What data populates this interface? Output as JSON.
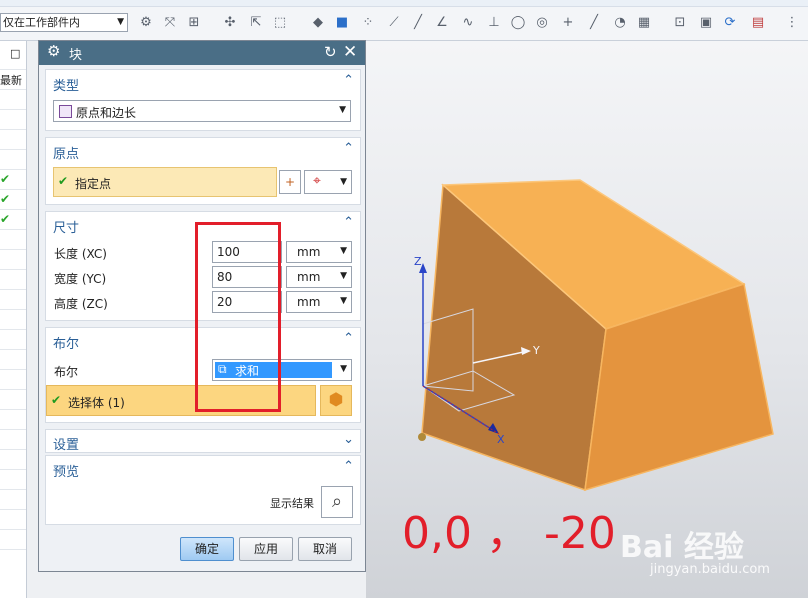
{
  "toolbar": {
    "scope_select": "仅在工作部件内",
    "icons": [
      "snap-icon",
      "filter-icon",
      "point-icon",
      "move-icon",
      "select-icon",
      "box-select-icon",
      "shade-icon",
      "cube-icon",
      "node-icon",
      "line-icon",
      "slash-icon",
      "angle-icon",
      "spline-icon",
      "tangent-icon",
      "circle-icon",
      "target-icon",
      "cross-icon",
      "slash2-icon",
      "sphere-icon",
      "grid-icon",
      "fit-icon",
      "view-icon",
      "refresh-icon",
      "layout-icon",
      "more-icon"
    ]
  },
  "navigator": {
    "header_label": "最新",
    "check_rows": [
      3,
      4,
      5
    ]
  },
  "dialog": {
    "title": "块",
    "type_section": {
      "title": "类型",
      "selected": "原点和边长"
    },
    "origin_section": {
      "title": "原点",
      "specify_point": "指定点"
    },
    "dimensions_section": {
      "title": "尺寸",
      "rows": [
        {
          "label": "长度 (XC)",
          "value": "100",
          "unit": "mm"
        },
        {
          "label": "宽度 (YC)",
          "value": "80",
          "unit": "mm"
        },
        {
          "label": "高度 (ZC)",
          "value": "20",
          "unit": "mm"
        }
      ]
    },
    "boolean_section": {
      "title": "布尔",
      "label": "布尔",
      "selected": "求和",
      "select_body": "选择体 (1)"
    },
    "settings_section": {
      "title": "设置"
    },
    "preview_section": {
      "title": "预览",
      "show_result": "显示结果"
    },
    "buttons": {
      "ok": "确定",
      "apply": "应用",
      "cancel": "取消"
    }
  },
  "viewport": {
    "axes": {
      "x": "X",
      "y": "Y",
      "z": "Z"
    },
    "body_color": "#f4a94a"
  },
  "annotation": {
    "text": "0,0 ， -20",
    "color": "#e21e2a"
  },
  "watermark": {
    "brand": "Bai 经验",
    "url": "jingyan.baidu.com"
  }
}
